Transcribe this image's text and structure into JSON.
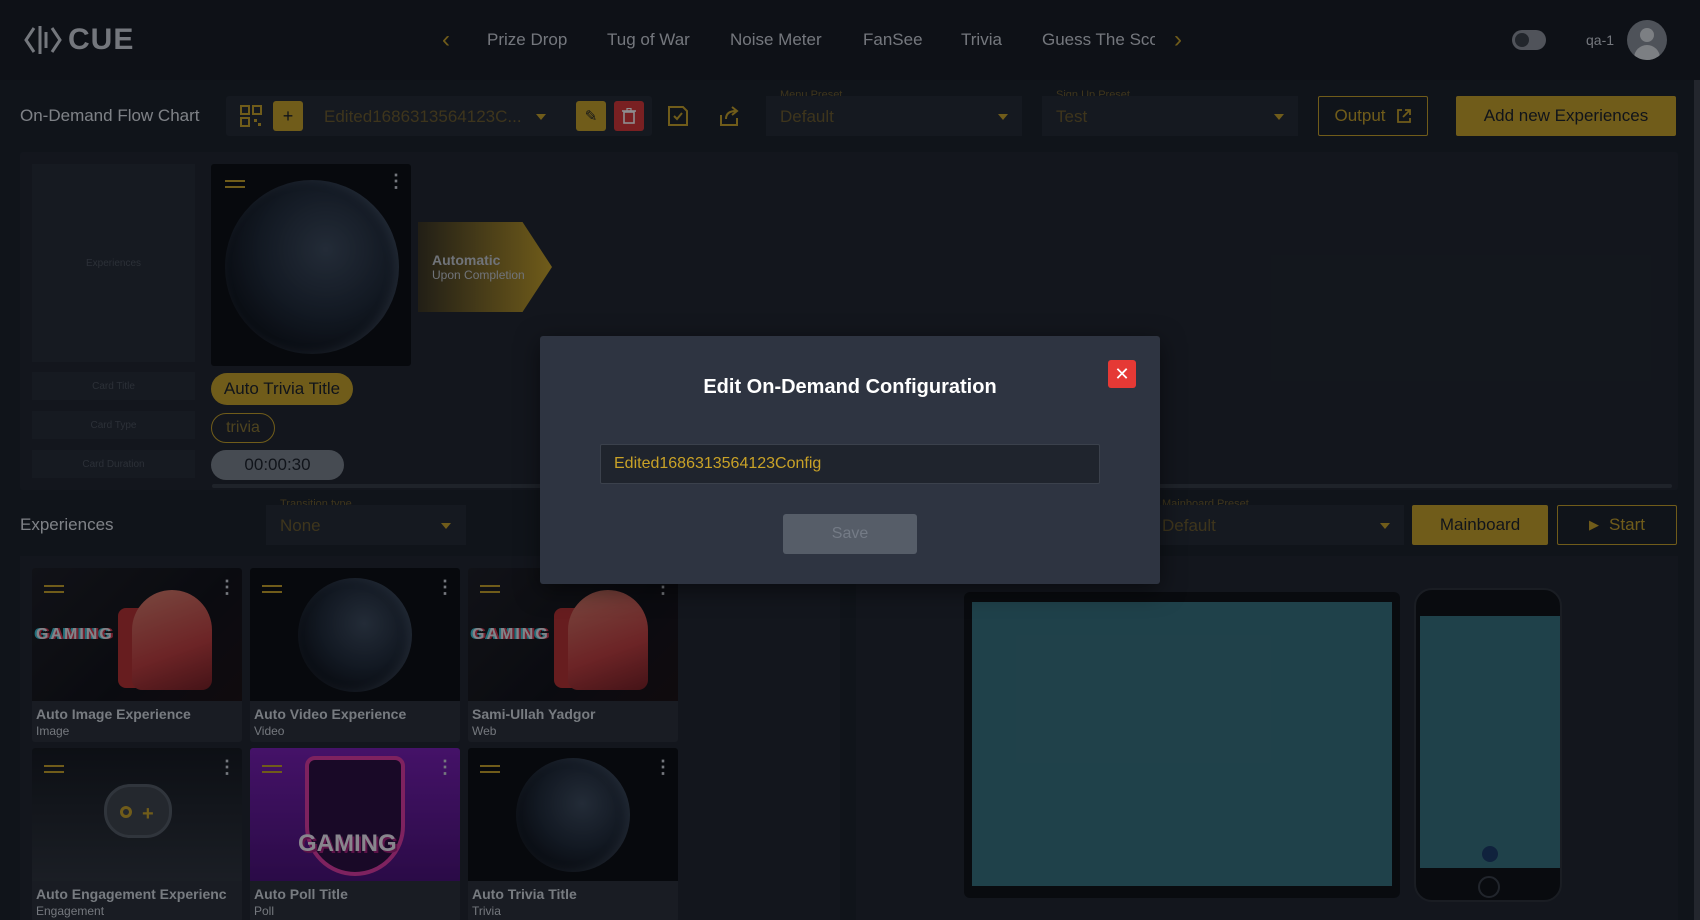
{
  "app": {
    "logo": "CUE"
  },
  "topnav": {
    "items": [
      "Prize Drop",
      "Tug of War",
      "Noise Meter",
      "FanSee",
      "Trivia",
      "Guess The Sco"
    ],
    "user": "qa-1"
  },
  "flowchart": {
    "title": "On-Demand Flow Chart",
    "config_value": "Edited1686313564123C...",
    "menu_preset": {
      "label": "Menu Preset",
      "value": "Default"
    },
    "signup_preset": {
      "label": "Sign Up Preset",
      "value": "Test"
    },
    "output_label": "Output",
    "add_label": "Add new Experiences",
    "placeholders": {
      "experiences": "Experiences",
      "card_title": "Card Title",
      "card_type": "Card Type",
      "card_duration": "Card Duration"
    },
    "card": {
      "title": "Auto Trivia Title",
      "type": "trivia",
      "duration": "00:00:30"
    },
    "transition": {
      "title": "Automatic",
      "subtitle": "Upon Completion"
    }
  },
  "experiences": {
    "title": "Experiences",
    "transition_type": {
      "label": "Transition type",
      "value": "None"
    },
    "cards": [
      {
        "title": "Auto Image Experience",
        "type": "Image",
        "thumb": "gaming-gamer"
      },
      {
        "title": "Auto Video Experience",
        "type": "Video",
        "thumb": "earth-night"
      },
      {
        "title": "Sami-Ullah Yadgor",
        "type": "Web",
        "thumb": "gaming-gamer"
      },
      {
        "title": "Auto Engagement Experienc",
        "type": "Engagement",
        "thumb": "gamepad"
      },
      {
        "title": "Auto Poll Title",
        "type": "Poll",
        "thumb": "gaming-team"
      },
      {
        "title": "Auto Trivia Title",
        "type": "Trivia",
        "thumb": "earth-night"
      }
    ],
    "gaming_word": "GAMING"
  },
  "mainboard": {
    "preset": {
      "label": "Mainboard Preset",
      "value": "Default"
    },
    "mainboard_label": "Mainboard",
    "start_label": "Start"
  },
  "modal": {
    "title": "Edit On-Demand Configuration",
    "input_value": "Edited1686313564123Config",
    "save_label": "Save"
  },
  "colors": {
    "accent": "#c9a227",
    "danger": "#e53935",
    "background": "#1b1f27",
    "modal": "#2e3441",
    "screen": "#36717f"
  }
}
